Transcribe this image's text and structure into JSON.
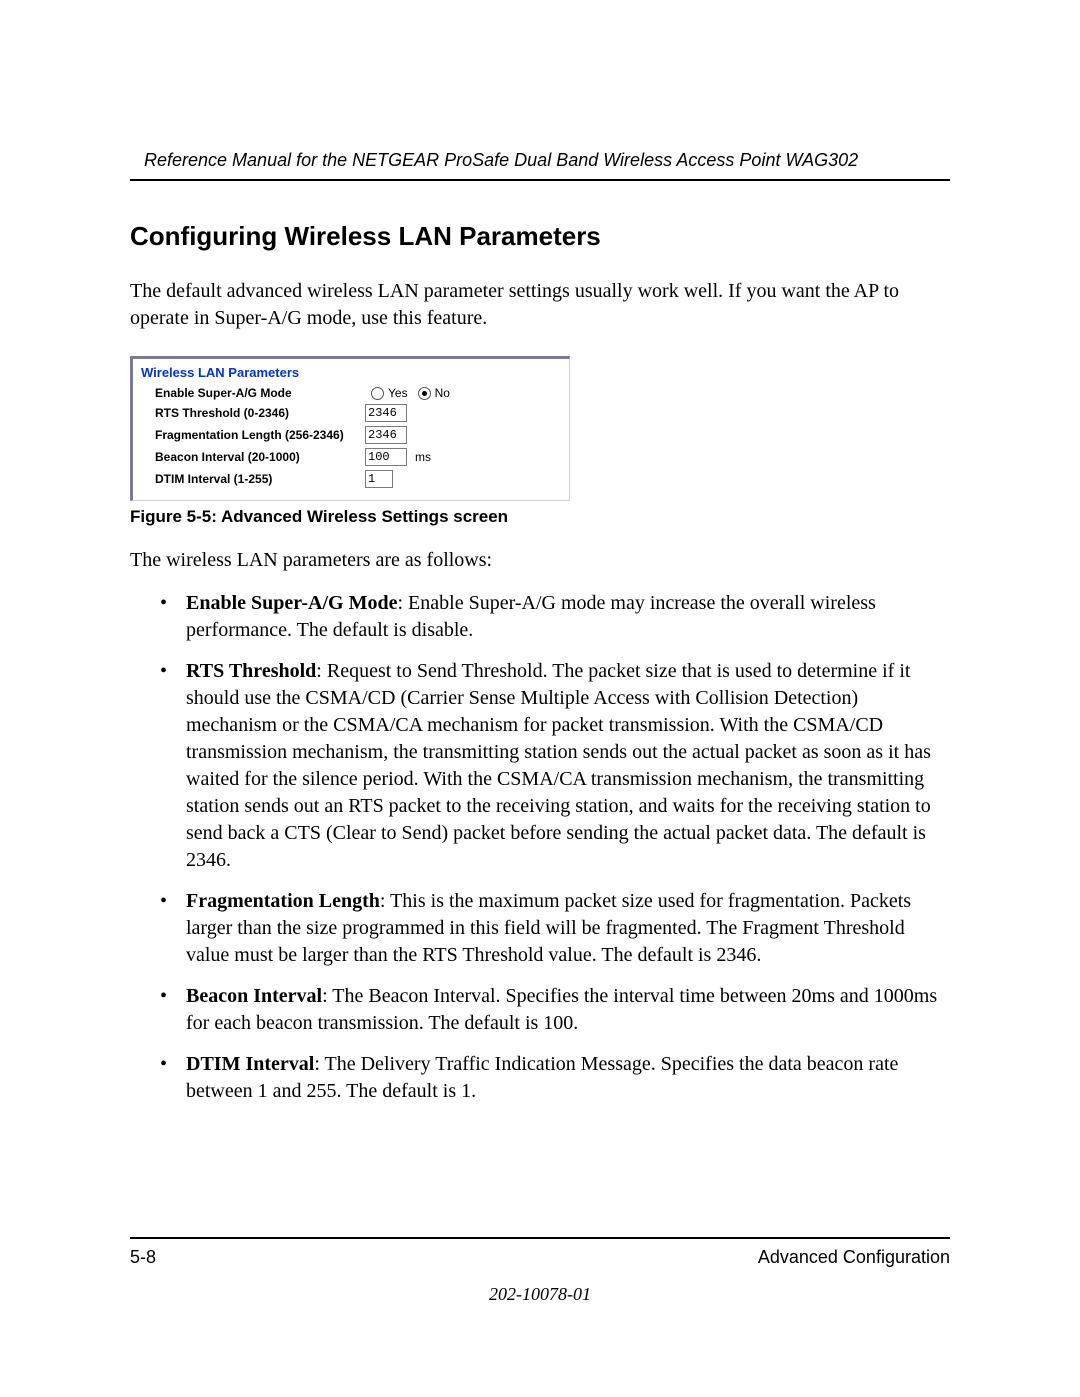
{
  "header": {
    "running": "Reference Manual for the NETGEAR ProSafe Dual Band Wireless Access Point WAG302"
  },
  "section": {
    "title": "Configuring Wireless LAN Parameters",
    "intro": "The default advanced wireless LAN parameter settings usually work well. If you want the AP to operate in Super-A/G mode, use this feature."
  },
  "panel": {
    "title": "Wireless LAN Parameters",
    "rows": {
      "super_ag": {
        "label": "Enable Super-A/G Mode",
        "yes": "Yes",
        "no": "No",
        "selected": "no"
      },
      "rts": {
        "label": "RTS Threshold (0-2346)",
        "value": "2346"
      },
      "frag": {
        "label": "Fragmentation Length (256-2346)",
        "value": "2346"
      },
      "beacon": {
        "label": "Beacon Interval (20-1000)",
        "value": "100",
        "unit": "ms"
      },
      "dtim": {
        "label": "DTIM Interval (1-255)",
        "value": "1"
      }
    }
  },
  "figure_caption": "Figure 5-5: Advanced Wireless Settings screen",
  "list_intro": "The wireless LAN parameters are as follows:",
  "bullets": {
    "b1": {
      "term": "Enable Super-A/G Mode",
      "text": ": Enable Super-A/G mode may increase the overall wireless performance. The default is disable."
    },
    "b2": {
      "term": "RTS Threshold",
      "text": ": Request to Send Threshold. The packet size that is used to determine if it should use the CSMA/CD (Carrier Sense Multiple Access with Collision Detection) mechanism or the CSMA/CA mechanism for packet transmission. With the CSMA/CD transmission mechanism, the transmitting station sends out the actual packet as soon as it has waited for the silence period. With the CSMA/CA transmission mechanism, the transmitting station sends out an RTS packet to the receiving station, and waits for the receiving station to send back a CTS (Clear to Send) packet before sending the actual packet data. The default is 2346."
    },
    "b3": {
      "term": "Fragmentation Length",
      "text": ": This is the maximum packet size used for fragmentation. Packets larger than the size programmed in this field will be fragmented. The Fragment Threshold value must be larger than the RTS Threshold value. The default is 2346."
    },
    "b4": {
      "term": "Beacon Interval",
      "text": ": The Beacon Interval. Specifies the interval time between 20ms and 1000ms for each beacon transmission. The default is 100."
    },
    "b5": {
      "term": "DTIM Interval",
      "text": ": The Delivery Traffic Indication Message. Specifies the data beacon rate between 1 and 255. The default is 1."
    }
  },
  "footer": {
    "page": "5-8",
    "chapter": "Advanced Configuration",
    "docnum": "202-10078-01"
  }
}
